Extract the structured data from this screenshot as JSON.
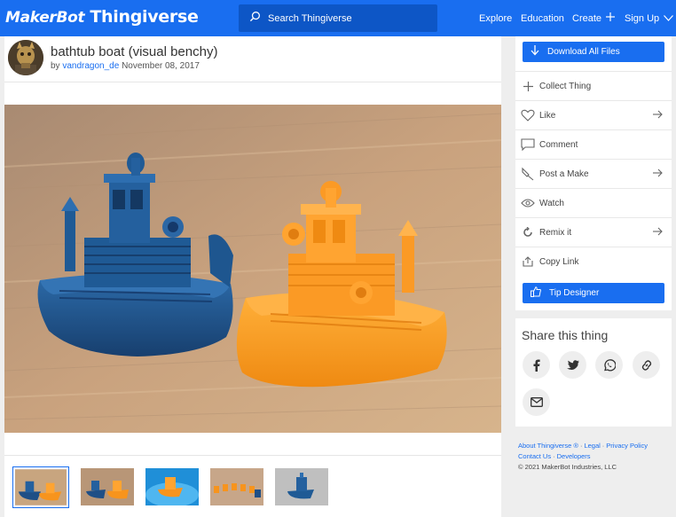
{
  "brand": {
    "maker": "MakerBot",
    "thingiverse": "Thingiverse"
  },
  "search": {
    "placeholder": "Search Thingiverse",
    "icon": "search-icon"
  },
  "nav": {
    "explore": "Explore",
    "education": "Education",
    "create": "Create",
    "signup": "Sign Up"
  },
  "thing": {
    "title": "bathtub boat (visual benchy)",
    "by": "by",
    "author": "vandragon_de",
    "date": "November 08, 2017"
  },
  "gallery": {
    "thumbnail_count": 5,
    "active_index": 0
  },
  "actions": {
    "download": "Download All Files",
    "collect": "Collect Thing",
    "like": "Like",
    "comment": "Comment",
    "post_make": "Post a Make",
    "watch": "Watch",
    "remix": "Remix it",
    "copy_link": "Copy Link",
    "tip": "Tip Designer"
  },
  "share": {
    "title": "Share this thing",
    "buttons": [
      "facebook-icon",
      "twitter-icon",
      "whatsapp-icon",
      "link-icon",
      "email-icon"
    ]
  },
  "footer": {
    "about": "About Thingiverse ®",
    "legal": "Legal",
    "privacy": "Privacy Policy",
    "contact": "Contact Us",
    "developers": "Developers",
    "copyright": "© 2021 MakerBot Industries, LLC"
  },
  "colors": {
    "accent": "#196ef0",
    "search_bg": "#0d56c6",
    "boat_blue": "#1f4f86",
    "boat_orange": "#f7941d"
  }
}
